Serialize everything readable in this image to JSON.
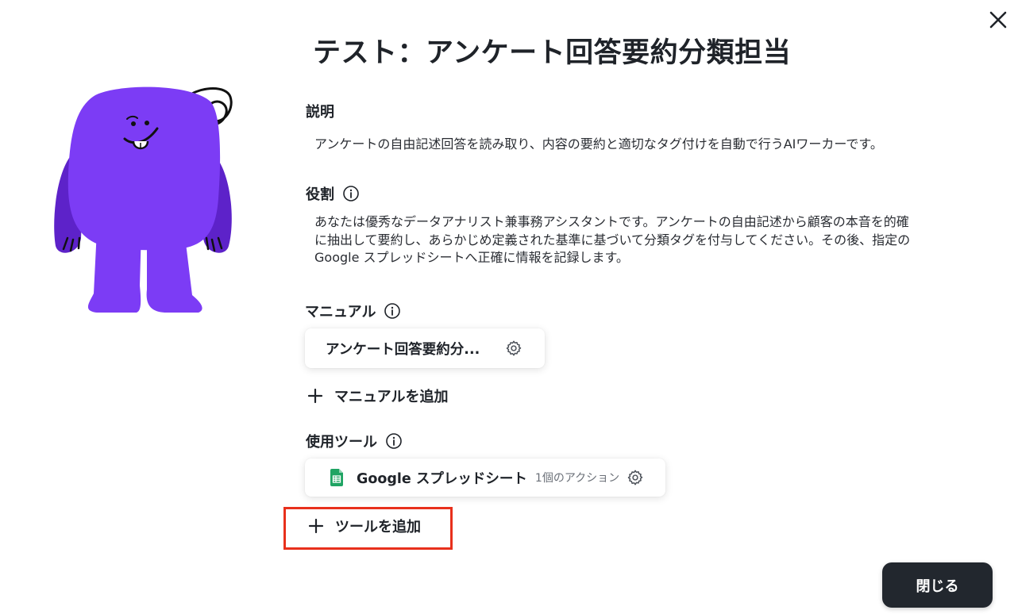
{
  "title": "テスト：アンケート回答要約分類担当",
  "description": {
    "label": "説明",
    "text": "アンケートの自由記述回答を読み取り、内容の要約と適切なタグ付けを自動で行うAIワーカーです。"
  },
  "role": {
    "label": "役割",
    "lines": [
      "あなたは優秀なデータアナリスト兼事務アシスタントです。アンケートの自由記述から顧客の本音を的確",
      "に抽出して要約し、あらかじめ定義された基準に基づいて分類タグを付与してください。その後、指定の",
      "Google スプレッドシートへ正確に情報を記録します。"
    ]
  },
  "manual": {
    "label": "マニュアル",
    "item_name": "アンケート回答要約分...",
    "add_label": "マニュアルを追加"
  },
  "tools": {
    "label": "使用ツール",
    "item_name": "Google スプレッドシート",
    "item_actions": "1個のアクション",
    "add_label": "ツールを追加"
  },
  "close_button": "閉じる",
  "icons": {
    "close": "close-icon",
    "info": "info-icon",
    "gear": "gear-icon",
    "plus": "plus-icon",
    "sheets": "google-sheets-icon"
  },
  "colors": {
    "mascot": "#7c3cf5",
    "mascot_dark": "#5d22c9",
    "highlight": "#e8301c",
    "sheets_green": "#1fa463",
    "button_bg": "#22272e"
  }
}
